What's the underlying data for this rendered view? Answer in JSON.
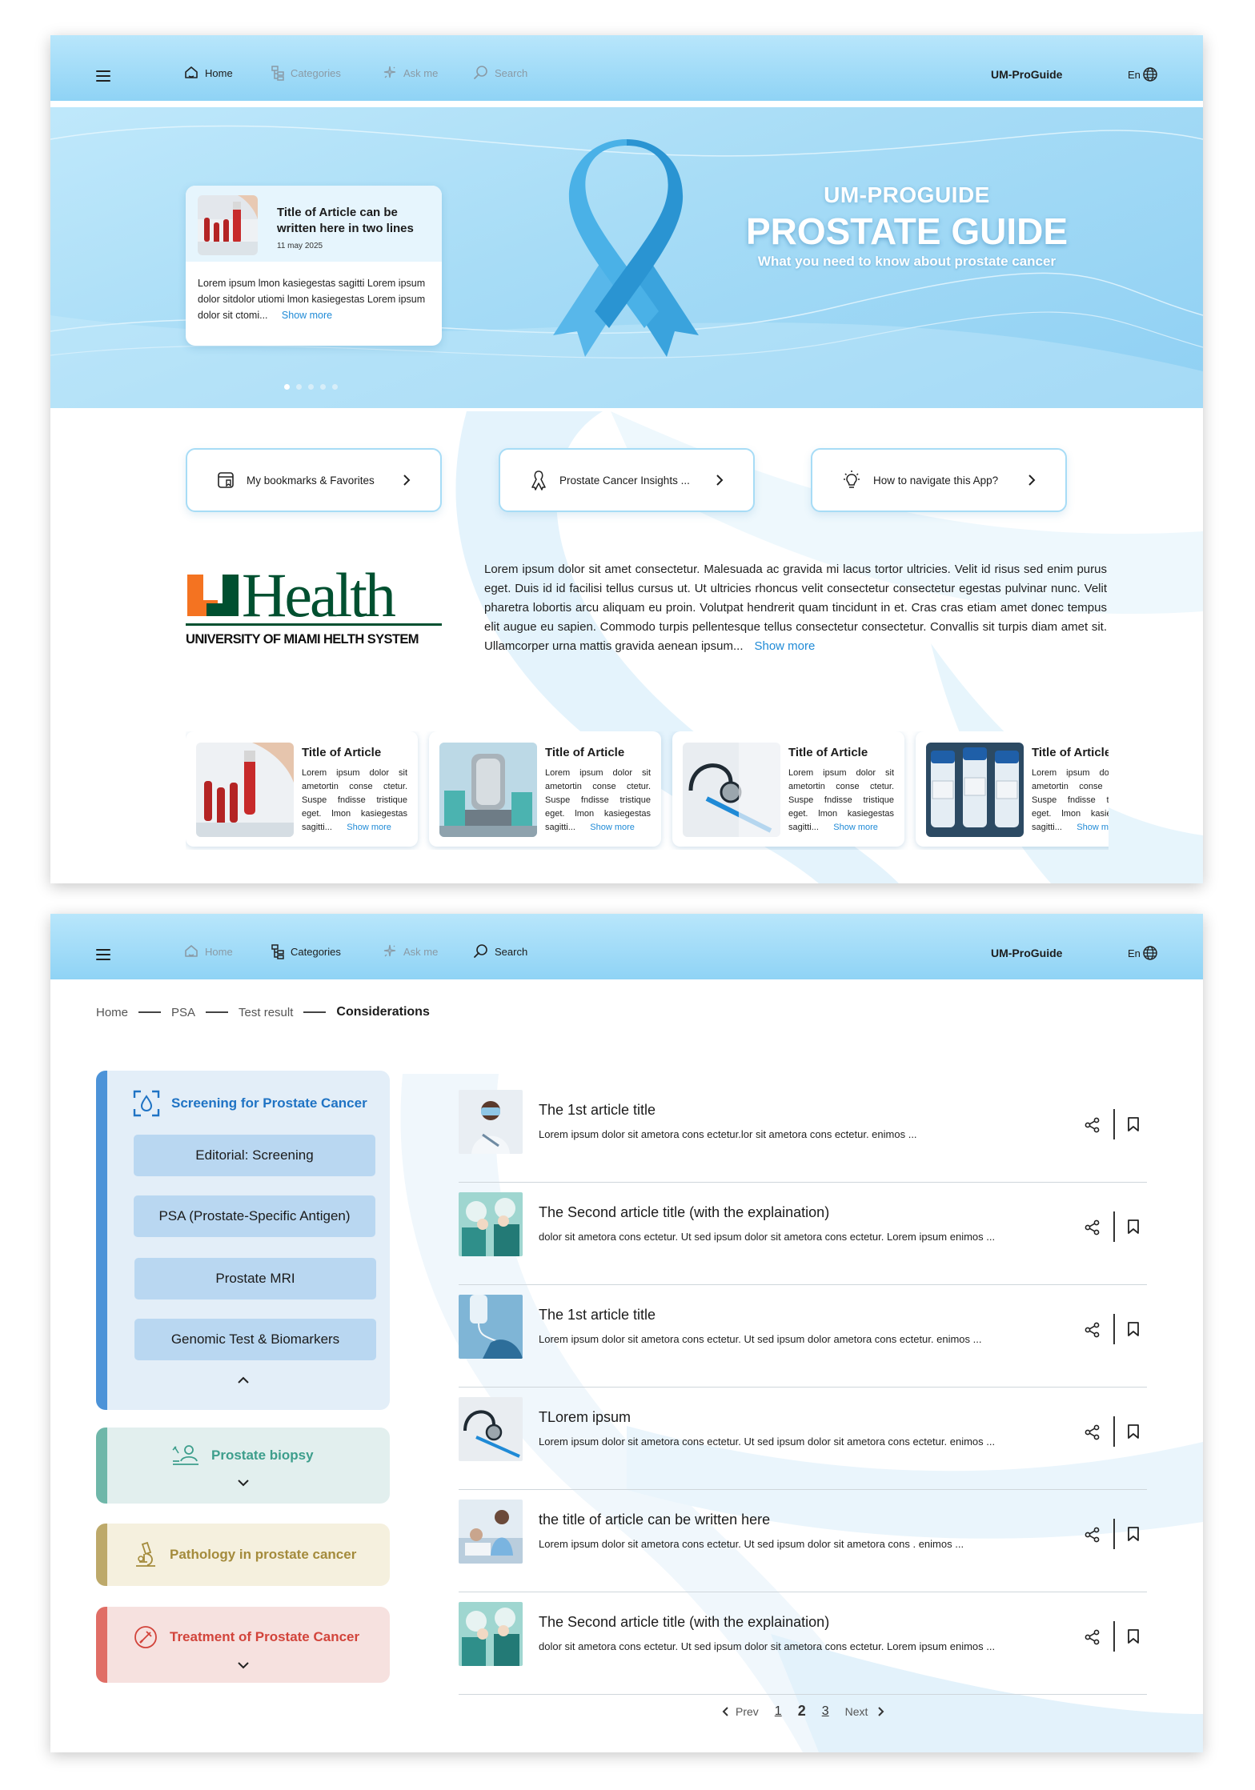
{
  "nav": {
    "items": [
      {
        "label": "Home",
        "icon": "home-icon"
      },
      {
        "label": "Categories",
        "icon": "categories-icon"
      },
      {
        "label": "Ask me",
        "icon": "sparkle-icon"
      },
      {
        "label": "Search",
        "icon": "search-icon"
      }
    ],
    "brand": "UM-ProGuide",
    "lang": "En"
  },
  "hero": {
    "card": {
      "title": "Title of Article can be written here in two lines",
      "date": "11 may 2025",
      "body": "Lorem ipsum lmon kasiegestas sagitti Lorem ipsum dolor sitdolor utiomi  lmon kasiegestas Lorem ipsum dolor sit  ctomi...",
      "more": "Show more"
    },
    "slides": 5,
    "active_slide": 1,
    "kicker": "UM-PROGUIDE",
    "title": "PROSTATE GUIDE",
    "subtitle": "What you need to know about prostate cancer"
  },
  "quick_links": [
    {
      "label": "My bookmarks & Favorites",
      "icon": "bookmark-list-icon"
    },
    {
      "label": "Prostate Cancer Insights ...",
      "icon": "ribbon-icon"
    },
    {
      "label": "How to navigate this App?",
      "icon": "lightbulb-icon"
    }
  ],
  "logo": {
    "mark": "UHealth",
    "caption": "UNIVERSITY OF MIAMI HELTH SYSTEM"
  },
  "intro": {
    "text": "Lorem ipsum dolor sit amet consectetur. Malesuada ac gravida mi lacus tortor ultricies. Velit id risus sed enim purus eget. Duis id id facilisi tellus cursus ut. Ut ultricies rhoncus velit consectetur consectetur egestas pulvinar nunc. Velit pharetra lobortis arcu aliquam eu proin. Volutpat hendrerit quam tincidunt in et. Cras cras etiam amet donec tempus elit augue eu sapien. Commodo turpis pellentesque tellus consectetur consectetur. Convallis sit turpis diam amet sit. Ullamcorper urna mattis gravida aenean ipsum...",
    "more": "Show more"
  },
  "article_cards": [
    {
      "title": "Title of Article",
      "body": "Lorem ipsum dolor sit ametortin conse ctetur. Suspe fndisse tristique eget. lmon kasiegestas sagitti...",
      "more": "Show more",
      "image": "blood-tube"
    },
    {
      "title": "Title of Article",
      "body": "Lorem ipsum dolor sit ametortin conse ctetur. Suspe fndisse tristique eget. lmon kasiegestas sagitti...",
      "more": "Show more",
      "image": "lab-machine"
    },
    {
      "title": "Title of Article",
      "body": "Lorem ipsum dolor sit ametortin conse ctetur. Suspe fndisse tristique eget. lmon kasiegestas sagitti...",
      "more": "Show more",
      "image": "stethoscope"
    },
    {
      "title": "Title of Article",
      "body": "Lorem ipsum dolor sit ametortin conse ctetur. Suspe fndisse tristique eget. lmon kasiegestas sagitti...",
      "more": "Show more",
      "image": "vaccine-vials"
    }
  ],
  "breadcrumb": [
    "Home",
    "PSA",
    "Test result",
    "Considerations"
  ],
  "sidebar": {
    "screening": {
      "title": "Screening for Prostate Cancer",
      "items": [
        "Editorial: Screening",
        "PSA  (Prostate-Specific Antigen)",
        "Prostate MRI",
        "Genomic Test & Biomarkers"
      ]
    },
    "biopsy": {
      "title": "Prostate biopsy"
    },
    "pathology": {
      "title": "Pathology in prostate cancer"
    },
    "treatment": {
      "title": "Treatment of Prostate Cancer"
    }
  },
  "articles": [
    {
      "title": "The 1st article title",
      "desc": "Lorem ipsum dolor sit ametora cons ectetur.lor sit ametora cons ectetur. enimos ...",
      "image": "doctor"
    },
    {
      "title": "The Second article title (with the explaination)",
      "desc": " dolor sit ametora cons ectetur. Ut sed ipsum dolor sit ametora cons ectetur. Lorem ipsum enimos ...",
      "image": "surgery"
    },
    {
      "title": "The 1st article title",
      "desc": "Lorem ipsum dolor sit ametora cons ectetur. Ut sed ipsum dolor ametora cons ectetur. enimos ...",
      "image": "iv-drip"
    },
    {
      "title": "TLorem ipsum",
      "desc": "Lorem ipsum dolor sit ametora cons ectetur. Ut sed ipsum dolor sit ametora cons ectetur. enimos ...",
      "image": "stethoscope"
    },
    {
      "title": "the title of article can be written here",
      "desc": "Lorem ipsum dolor sit ametora cons ectetur. Ut sed ipsum dolor sit ametora cons . enimos ...",
      "image": "patient-care"
    },
    {
      "title": "The Second article title (with the explaination)",
      "desc": " dolor sit ametora cons ectetur. Ut sed ipsum dolor sit ametora cons ectetur. Lorem ipsum enimos ...",
      "image": "surgery"
    }
  ],
  "pagination": {
    "prev": "Prev",
    "pages": [
      "1",
      "2",
      "3"
    ],
    "current": "2",
    "next": "Next"
  },
  "colors": {
    "accent": "#1f73c4",
    "link": "#1f8ad6",
    "nav_bg": "#a7dcf6",
    "screening": "#4c93d8",
    "biopsy": "#6fb7a9",
    "pathology": "#bda96a",
    "treatment": "#e06e66",
    "um_orange": "#f47321",
    "um_green": "#005030"
  }
}
